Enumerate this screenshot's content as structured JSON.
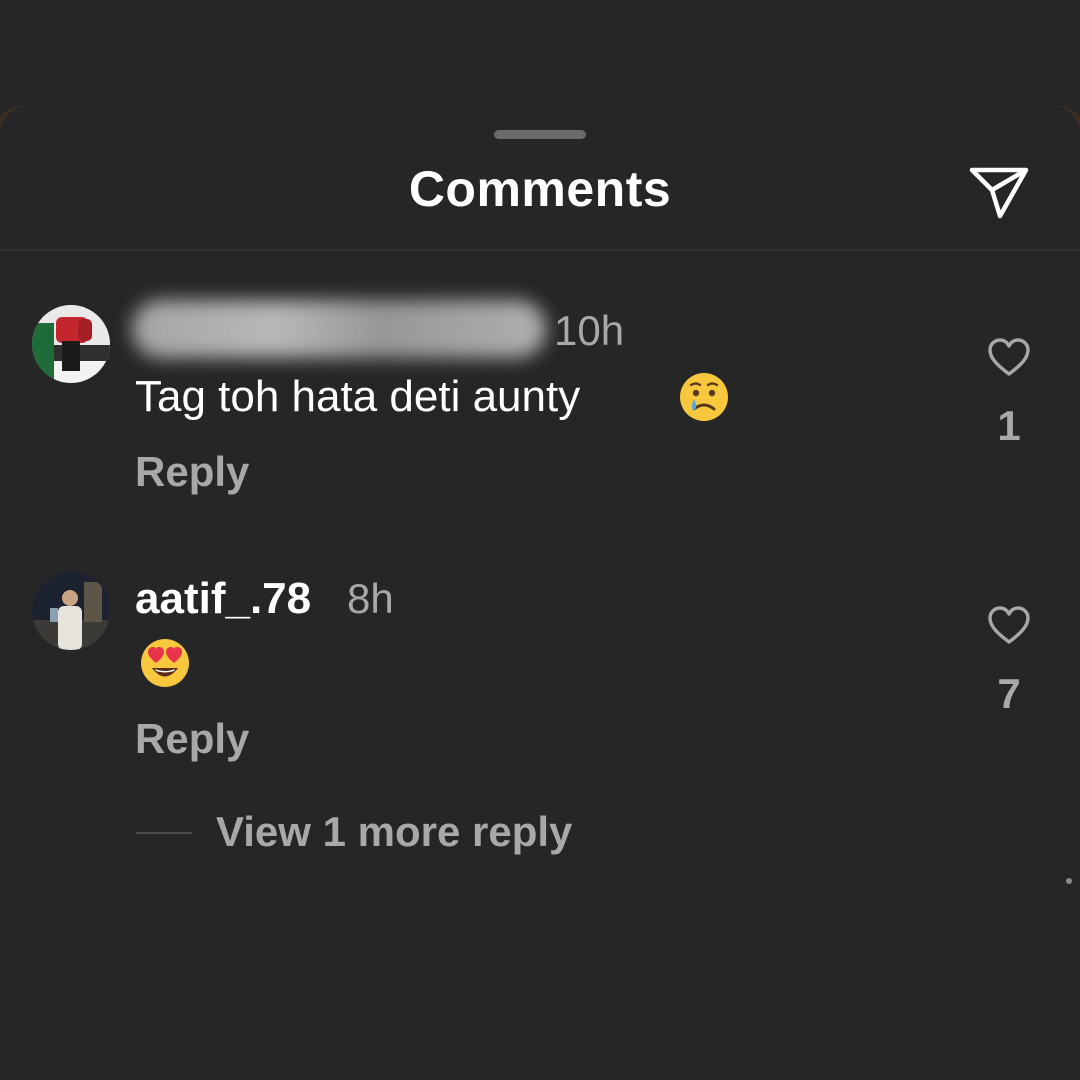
{
  "header": {
    "title": "Comments"
  },
  "comments": [
    {
      "time": "10h",
      "text": "Tag toh hata deti aunty",
      "emoji": "crying-face",
      "reply_label": "Reply",
      "likes": "1"
    },
    {
      "username": "aatif_.78",
      "time": "8h",
      "emoji": "heart-eyes-face",
      "reply_label": "Reply",
      "likes": "7"
    }
  ],
  "more_replies_label": "View 1 more reply",
  "colors": {
    "background": "#262626",
    "primary_text": "#ffffff",
    "secondary_text": "#a8a8a8"
  }
}
